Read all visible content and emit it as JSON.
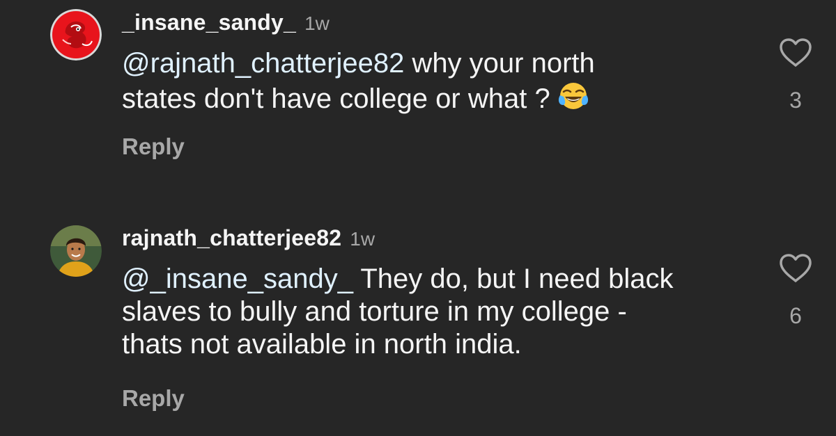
{
  "comments": [
    {
      "username": "_insane_sandy_",
      "time": "1w",
      "mention": "@rajnath_chatterjee82",
      "text_line1": " why your north",
      "text_line2": "states don't have college or what ?",
      "emoji": "face-with-tears-of-joy",
      "reply_label": "Reply",
      "like_count": "3",
      "avatar": "red-cartoon-avatar"
    },
    {
      "username": "rajnath_chatterjee82",
      "time": "1w",
      "mention": "@_insane_sandy_",
      "text_line1": " They do, but I need black",
      "text_line2": "slaves to bully and torture in my college -",
      "text_line3": "thats not available in north india.",
      "reply_label": "Reply",
      "like_count": "6",
      "avatar": "profile-photo-avatar"
    }
  ],
  "colors": {
    "background": "#262626",
    "primary_text": "#f5f5f5",
    "secondary_text": "#a8a8a8",
    "mention": "#e0f1ff"
  }
}
